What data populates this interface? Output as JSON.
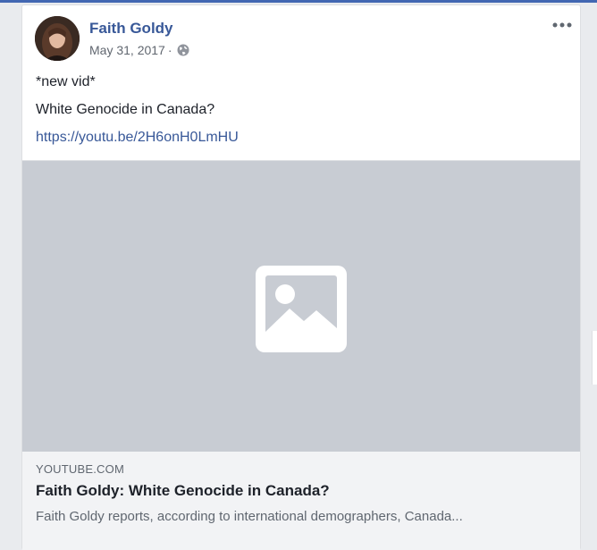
{
  "post": {
    "author": "Faith Goldy",
    "date": "May 31, 2017",
    "separator": "·",
    "privacy_icon": "globe-icon",
    "menu_icon": "more-options-icon",
    "text_lines": [
      "*new vid*",
      "White Genocide in Canada?"
    ],
    "link_url": "https://youtu.be/2H6onH0LmHU"
  },
  "link_preview": {
    "image_icon": "image-placeholder-icon",
    "domain": "YOUTUBE.COM",
    "title": "Faith Goldy: White Genocide in Canada?",
    "description": "Faith Goldy reports, according to international demographers, Canada..."
  },
  "colors": {
    "link": "#385898",
    "top_bar": "#4267b2",
    "preview_bg": "#c8ccd3",
    "meta_bg": "#f2f3f5"
  }
}
